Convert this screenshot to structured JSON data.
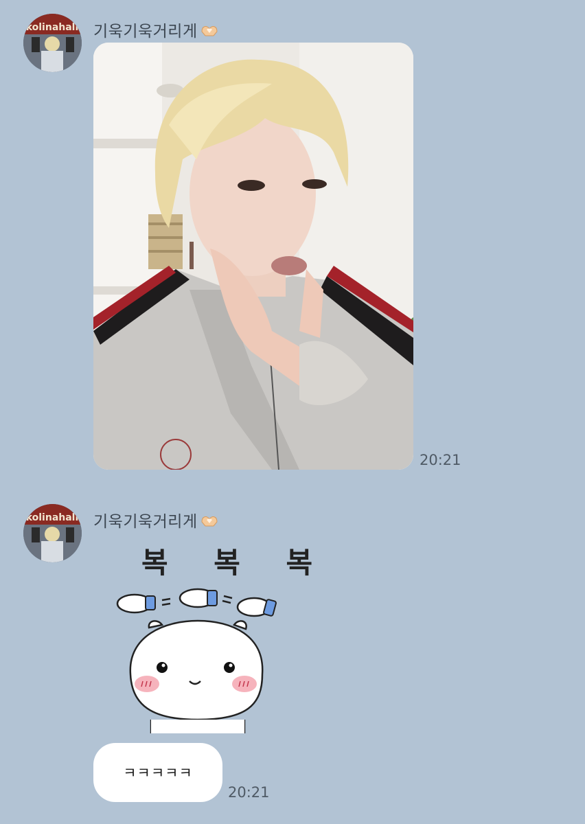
{
  "messages": [
    {
      "sender": "기욱기욱거리게",
      "sender_emoji": "heart-hands-icon",
      "type": "photo",
      "time": "20:21"
    },
    {
      "sender": "기욱기욱거리게",
      "sender_emoji": "heart-hands-icon",
      "type": "sticker",
      "sticker_text": "복 복 복"
    },
    {
      "type": "text",
      "text": "ㅋㅋㅋㅋㅋ",
      "time": "20:21"
    }
  ],
  "colors": {
    "background": "#b2c3d4",
    "bubble": "#ffffff"
  }
}
